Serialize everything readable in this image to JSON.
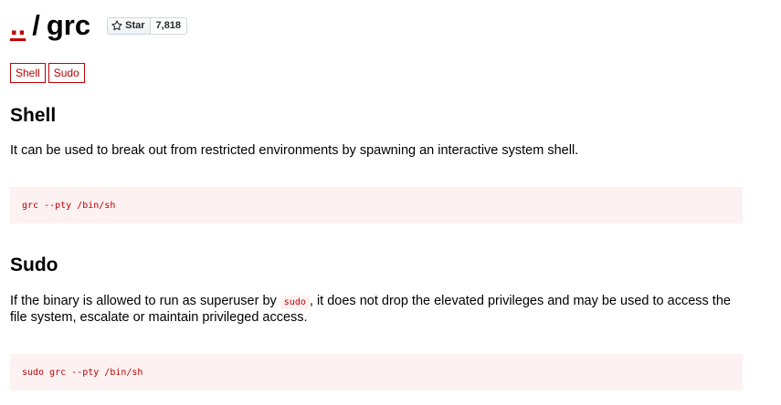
{
  "header": {
    "up_link": "..",
    "separator": "/",
    "binary_name": "grc",
    "star_button_label": "Star",
    "star_count": "7,818"
  },
  "tags": [
    "Shell",
    "Sudo"
  ],
  "sections": {
    "shell": {
      "heading": "Shell",
      "description": "It can be used to break out from restricted environments by spawning an interactive system shell.",
      "code": "grc --pty /bin/sh"
    },
    "sudo": {
      "heading": "Sudo",
      "description_before": "If the binary is allowed to run as superuser by ",
      "inline_code": "sudo",
      "description_after": ", it does not drop the elevated privileges and may be used to access the file system, escalate or maintain privileged access.",
      "code": "sudo grc --pty /bin/sh"
    }
  },
  "colors": {
    "accent": "#c00000",
    "code_background": "#fdf1f1"
  }
}
